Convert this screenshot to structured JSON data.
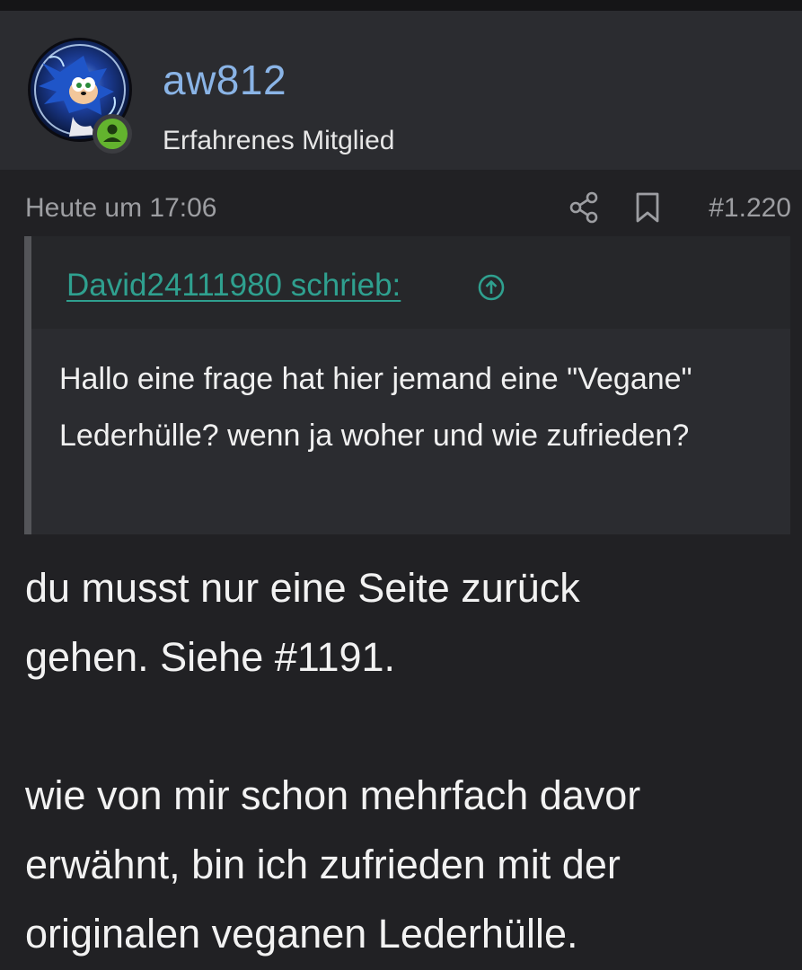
{
  "post": {
    "author": {
      "name": "aw812",
      "title": "Erfahrenes Mitglied",
      "avatar_icon": "sonic-avatar",
      "online_badge_icon": "user-online-icon"
    },
    "meta": {
      "date": "Heute um 17:06",
      "share_icon": "share-icon",
      "bookmark_icon": "bookmark-icon",
      "post_number": "#1.220"
    },
    "quote": {
      "author_line": "David24111980 schrieb:",
      "jump_icon": "arrow-up-circle-icon",
      "text": "Hallo eine frage hat hier jemand eine \"Vegane\" Lederhülle? wenn ja woher und wie zufrieden?"
    },
    "body": {
      "paragraph_1": "du musst nur eine Seite zurück gehen. Siehe #1191.",
      "paragraph_2": "wie von mir schon mehrfach davor erwähnt, bin ich zufrieden mit der originalen veganen Lederhülle."
    },
    "colors": {
      "background": "#212124",
      "header_bg": "#2b2c30",
      "username": "#8ab4e6",
      "quote_link": "#2fa08f",
      "online_badge": "#63b32e"
    }
  }
}
